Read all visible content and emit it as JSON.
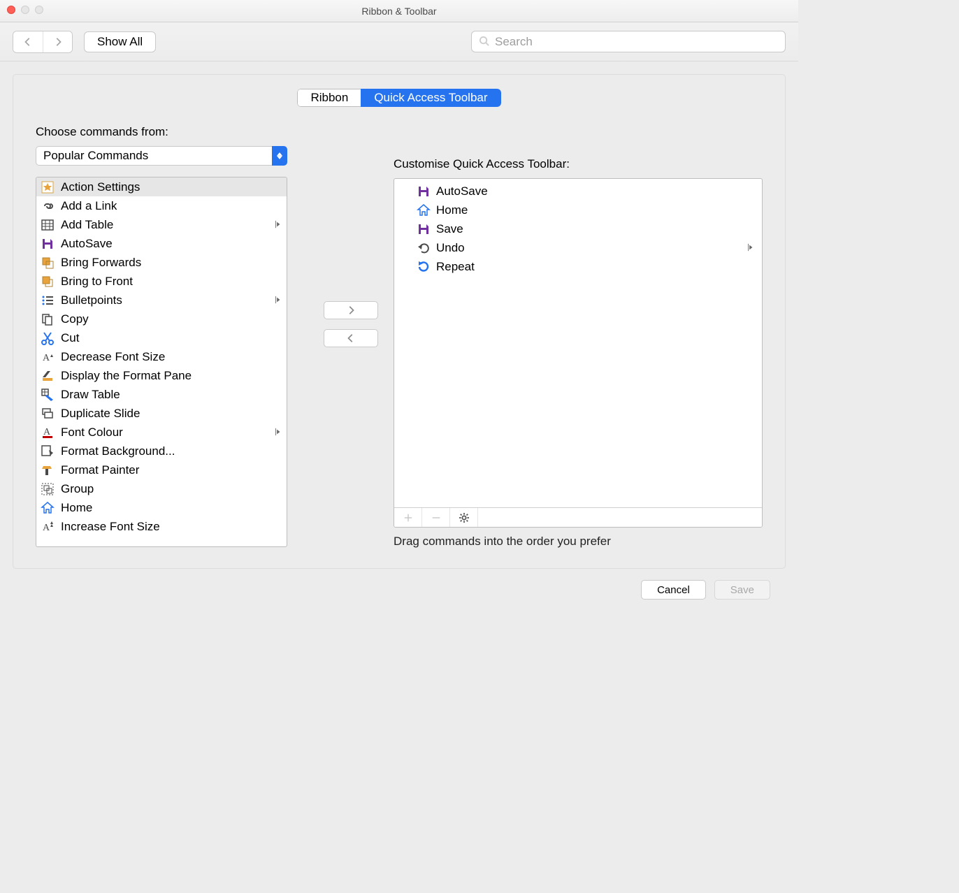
{
  "window_title": "Ribbon & Toolbar",
  "toolbar": {
    "show_all": "Show All",
    "search_placeholder": "Search"
  },
  "tabs": {
    "left": "Ribbon",
    "right": "Quick Access Toolbar"
  },
  "left_panel": {
    "label": "Choose commands from:",
    "dropdown_value": "Popular Commands",
    "items": [
      {
        "label": "Action Settings",
        "icon": "star",
        "selected": true
      },
      {
        "label": "Add a Link",
        "icon": "link"
      },
      {
        "label": "Add Table",
        "icon": "table",
        "submenu": true
      },
      {
        "label": "AutoSave",
        "icon": "save-purple"
      },
      {
        "label": "Bring Forwards",
        "icon": "bring-fwd"
      },
      {
        "label": "Bring to Front",
        "icon": "bring-front"
      },
      {
        "label": "Bulletpoints",
        "icon": "bullets",
        "submenu": true
      },
      {
        "label": "Copy",
        "icon": "copy"
      },
      {
        "label": "Cut",
        "icon": "cut"
      },
      {
        "label": "Decrease Font Size",
        "icon": "font-dec"
      },
      {
        "label": "Display the Format Pane",
        "icon": "format-pane"
      },
      {
        "label": "Draw Table",
        "icon": "draw-table"
      },
      {
        "label": "Duplicate Slide",
        "icon": "dup-slide"
      },
      {
        "label": "Font Colour",
        "icon": "font-colour",
        "submenu": true
      },
      {
        "label": "Format Background...",
        "icon": "format-bg"
      },
      {
        "label": "Format Painter",
        "icon": "painter"
      },
      {
        "label": "Group",
        "icon": "group"
      },
      {
        "label": "Home",
        "icon": "home"
      },
      {
        "label": "Increase Font Size",
        "icon": "font-inc"
      }
    ]
  },
  "right_panel": {
    "label": "Customise Quick Access Toolbar:",
    "items": [
      {
        "label": "AutoSave",
        "icon": "save-purple"
      },
      {
        "label": "Home",
        "icon": "home"
      },
      {
        "label": "Save",
        "icon": "save-purple"
      },
      {
        "label": "Undo",
        "icon": "undo",
        "submenu": true
      },
      {
        "label": "Repeat",
        "icon": "repeat"
      }
    ],
    "hint": "Drag commands into the order you prefer"
  },
  "footer": {
    "cancel": "Cancel",
    "save": "Save"
  }
}
